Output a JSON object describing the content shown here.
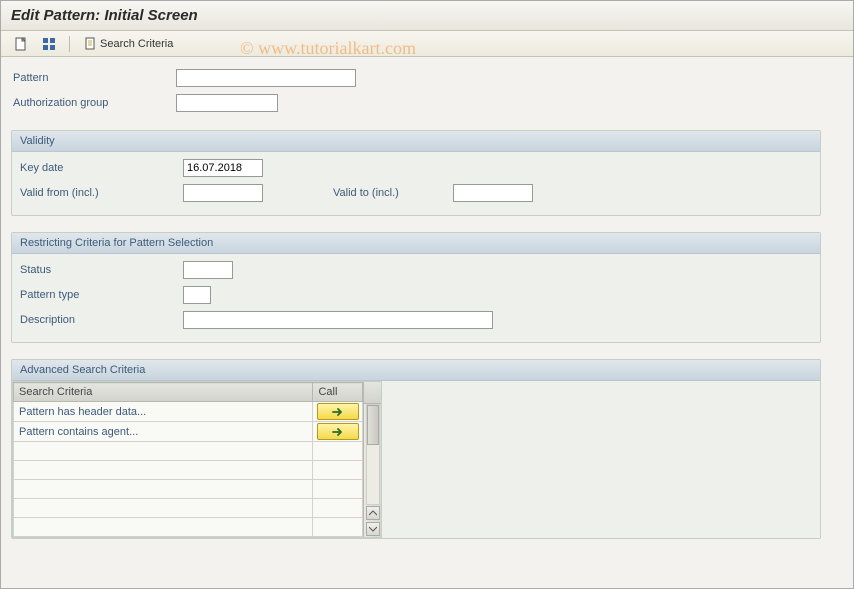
{
  "title": "Edit Pattern: Initial Screen",
  "watermark": "© www.tutorialkart.com",
  "toolbar": {
    "search_criteria_label": "Search Criteria"
  },
  "form": {
    "pattern_label": "Pattern",
    "pattern_value": "",
    "authgroup_label": "Authorization group",
    "authgroup_value": ""
  },
  "validity": {
    "title": "Validity",
    "keydate_label": "Key date",
    "keydate_value": "16.07.2018",
    "validfrom_label": "Valid from (incl.)",
    "validfrom_value": "",
    "validto_label": "Valid to (incl.)",
    "validto_value": ""
  },
  "restrict": {
    "title": "Restricting Criteria for Pattern Selection",
    "status_label": "Status",
    "status_value": "",
    "ptype_label": "Pattern type",
    "ptype_value": "",
    "desc_label": "Description",
    "desc_value": ""
  },
  "advanced": {
    "title": "Advanced Search Criteria",
    "col_criteria": "Search Criteria",
    "col_call": "Call",
    "rows": [
      {
        "label": "Pattern has header data..."
      },
      {
        "label": "Pattern contains agent..."
      }
    ]
  }
}
